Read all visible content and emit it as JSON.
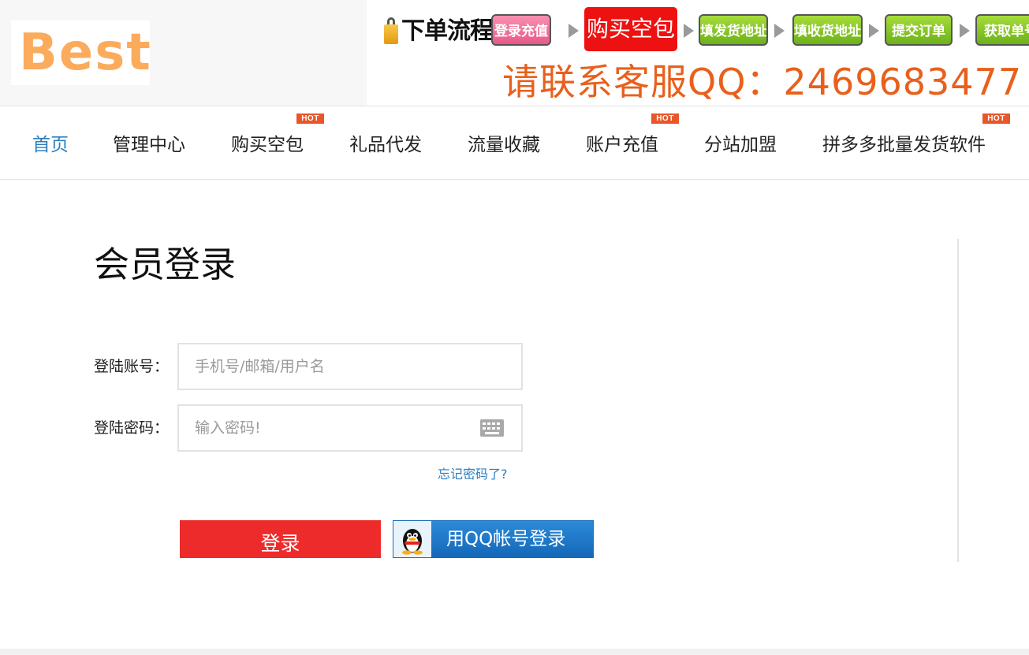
{
  "header": {
    "logo_text": "Best",
    "flow_title": "下单流程:",
    "steps": [
      "登录充值",
      "购买空包",
      "填发货地址",
      "填收货地址",
      "提交订单",
      "获取单号"
    ],
    "contact": "请联系客服QQ：2469683477"
  },
  "nav": {
    "items": [
      {
        "label": "首页",
        "active": true,
        "hot": false
      },
      {
        "label": "管理中心",
        "active": false,
        "hot": false
      },
      {
        "label": "购买空包",
        "active": false,
        "hot": true
      },
      {
        "label": "礼品代发",
        "active": false,
        "hot": false
      },
      {
        "label": "流量收藏",
        "active": false,
        "hot": false
      },
      {
        "label": "账户充值",
        "active": false,
        "hot": true
      },
      {
        "label": "分站加盟",
        "active": false,
        "hot": false
      },
      {
        "label": "拼多多批量发货软件",
        "active": false,
        "hot": true
      }
    ],
    "hot_badge": "HOT"
  },
  "login": {
    "title": "会员登录",
    "account_label": "登陆账号：",
    "account_placeholder": "手机号/邮箱/用户名",
    "account_value": "",
    "password_label": "登陆密码：",
    "password_placeholder": "输入密码!",
    "password_value": "",
    "forgot_link": "忘记密码了?",
    "login_button": "登录",
    "qq_login_button": "用QQ帐号登录"
  },
  "colors": {
    "accent_blue": "#2a7fc0",
    "login_red": "#ee2b2b",
    "hot_badge": "#e8562a",
    "contact_orange": "#e8601c",
    "logo_orange": "#fbab5c"
  }
}
